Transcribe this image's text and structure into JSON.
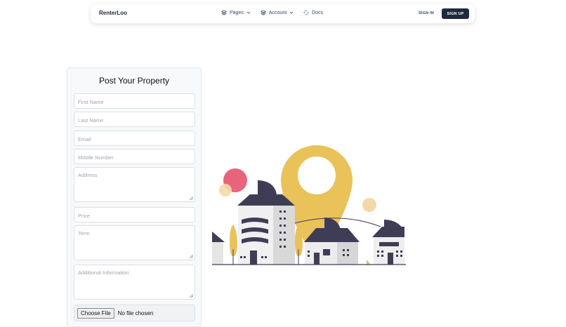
{
  "navbar": {
    "brand": "RenterLoo",
    "links": [
      {
        "label": "Pages",
        "icon": "stack-icon",
        "has_dropdown": true
      },
      {
        "label": "Account",
        "icon": "stack-icon",
        "has_dropdown": true
      },
      {
        "label": "Docs",
        "icon": "dots-circle-icon",
        "has_dropdown": false
      }
    ],
    "sign_in": "SIGN IN",
    "sign_up": "SIGN UP"
  },
  "form": {
    "title": "Post Your Property",
    "fields": {
      "first_name": {
        "placeholder": "First Name",
        "value": ""
      },
      "last_name": {
        "placeholder": "Last Name",
        "value": ""
      },
      "email": {
        "placeholder": "Email",
        "value": ""
      },
      "mobile": {
        "placeholder": "Mobile Number",
        "value": ""
      },
      "address": {
        "placeholder": "Address",
        "value": ""
      },
      "price": {
        "placeholder": "Price",
        "value": ""
      },
      "term": {
        "placeholder": "Term",
        "value": ""
      },
      "additional": {
        "placeholder": "Additional Information",
        "value": ""
      }
    },
    "file": {
      "button_label": "Choose File",
      "status": "No file chosen"
    }
  },
  "colors": {
    "accent_dark": "#1f2a3c",
    "pin_yellow": "#e9c25a",
    "circle_pink": "#e8647c",
    "building_dark": "#3f3d56"
  }
}
